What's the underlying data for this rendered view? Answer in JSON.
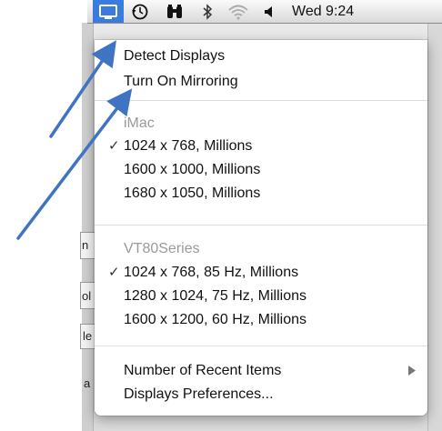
{
  "menubar": {
    "icons": [
      "display-icon",
      "time-machine-icon",
      "spotlight-binoculars-icon",
      "bluetooth-icon",
      "wifi-icon",
      "volume-icon"
    ],
    "clock": "Wed 9:24"
  },
  "menu": {
    "detect_displays": "Detect Displays",
    "turn_on_mirroring": "Turn On Mirroring",
    "group1": {
      "header": "iMac",
      "items": [
        {
          "label": "1024 x 768, Millions",
          "checked": true
        },
        {
          "label": "1600 x 1000, Millions",
          "checked": false
        },
        {
          "label": "1680 x 1050, Millions",
          "checked": false
        }
      ]
    },
    "group2": {
      "header": "VT80Series",
      "items": [
        {
          "label": "1024 x 768, 85 Hz, Millions",
          "checked": true
        },
        {
          "label": "1280 x 1024, 75 Hz, Millions",
          "checked": false
        },
        {
          "label": "1600 x 1200, 60 Hz, Millions",
          "checked": false
        }
      ]
    },
    "recent_items": "Number of Recent Items",
    "preferences": "Displays Preferences...",
    "check_mark": "✓"
  },
  "background_fragments": [
    "n",
    "ol",
    "le",
    "a"
  ],
  "colors": {
    "menubar_highlight": "#3a7be0",
    "arrow": "#3f74c2"
  }
}
